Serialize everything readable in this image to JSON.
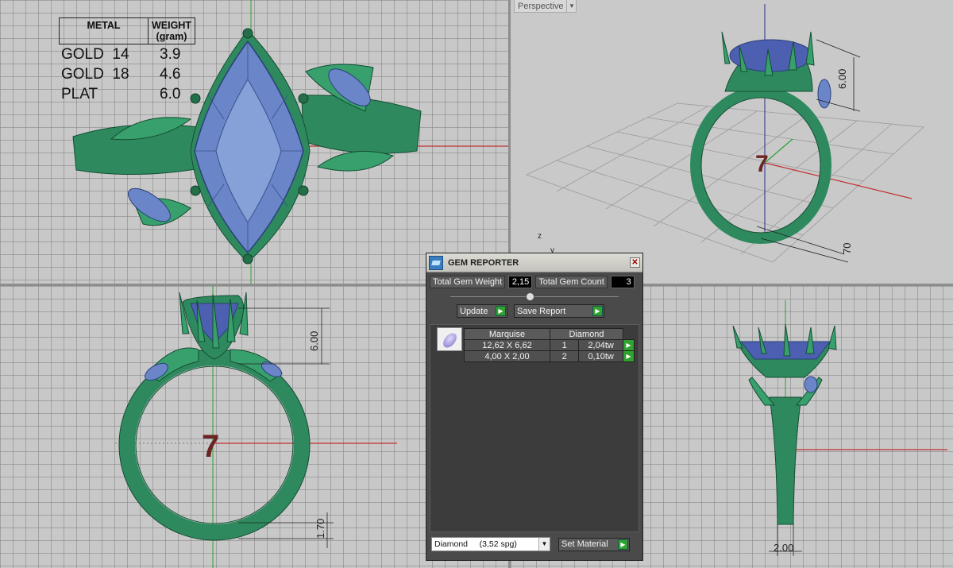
{
  "metal_table": {
    "header_metal": "METAL",
    "header_weight": "WEIGHT",
    "header_weight_unit": "(gram)",
    "rows": [
      {
        "metal": "GOLD  14",
        "weight": "3.9"
      },
      {
        "metal": "GOLD  18",
        "weight": "4.6"
      },
      {
        "metal": "PLAT",
        "weight": "6.0"
      }
    ]
  },
  "viewports": {
    "perspective_label": "Perspective",
    "ring_size": "7",
    "dim_top_height": "6.00",
    "dim_shank": "1.70",
    "dim_persp_height": "6.00",
    "dim_persp_shank": "70",
    "dim_side_width": "2.00",
    "axis_z": "z",
    "axis_y": "y"
  },
  "gem_reporter": {
    "title": "GEM REPORTER",
    "total_weight_label": "Total Gem Weight",
    "total_weight_value": "2,15",
    "total_count_label": "Total Gem Count",
    "total_count_value": "3",
    "update_label": "Update",
    "save_report_label": "Save Report",
    "table_headers": [
      "Marquise",
      "Diamond"
    ],
    "rows": [
      {
        "size": "12,62 X 6,62",
        "count": "1",
        "weight": "2,04tw"
      },
      {
        "size": "4,00 X 2,00",
        "count": "2",
        "weight": "0,10tw"
      }
    ],
    "material_select": "Diamond     (3,52 spg)",
    "set_material_label": "Set Material"
  },
  "colors": {
    "ring_green": "#2e8a5e",
    "gem_blue": "#6a86c8",
    "axis_red": "#c03030",
    "axis_green": "#2fa22f"
  }
}
